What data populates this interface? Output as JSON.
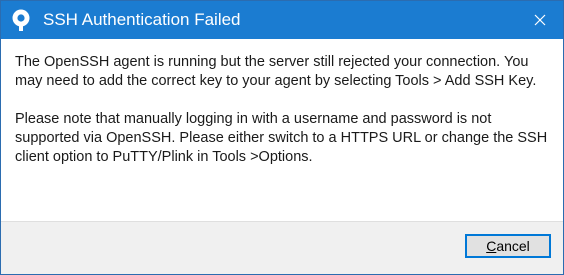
{
  "dialog": {
    "title": "SSH Authentication Failed",
    "message_1": "The OpenSSH agent is running but the server still rejected your connection. You may need to add the correct key to your agent by selecting Tools > Add SSH Key.",
    "message_2": "Please note that manually logging in with a username and password is not supported via OpenSSH. Please either switch to a HTTPS URL or change the SSH client option to PuTTY/Plink in Tools >Options.",
    "cancel_access_key": "C",
    "cancel_rest": "ancel",
    "icons": {
      "app": "sourcetree-icon",
      "close": "close-icon"
    },
    "colors": {
      "titlebar": "#1b7cd1",
      "footer": "#f0f0f0",
      "focus_border": "#0078d7"
    }
  }
}
